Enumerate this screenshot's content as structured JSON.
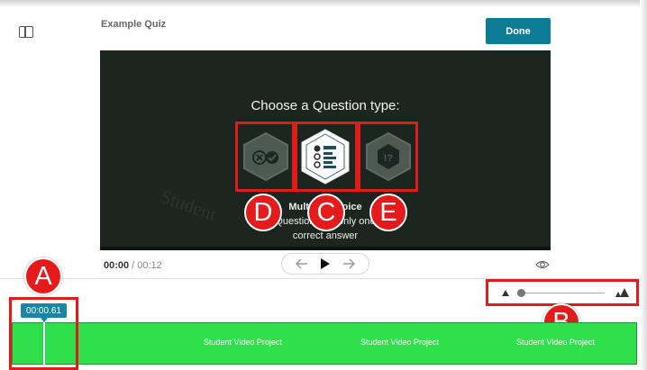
{
  "header": {
    "quiz_title": "Example Quiz",
    "done_label": "Done"
  },
  "video": {
    "watermark": "Student",
    "prompt": "Choose a Question type:",
    "question_types": [
      {
        "letter": "D",
        "icon": "true-false-icon"
      },
      {
        "letter": "C",
        "icon": "multiple-choice-icon"
      },
      {
        "letter": "E",
        "icon": "reveal-question-icon"
      }
    ],
    "description": {
      "line1": "Multiple Choice",
      "line2": "Question with only one",
      "line3": "correct answer"
    }
  },
  "annotations": {
    "a": "A",
    "b": "B",
    "c": "C",
    "d": "D",
    "e": "E"
  },
  "player": {
    "current_time": "00:00",
    "separator": "/",
    "total_time": "00:12",
    "zoom_level": 0.02
  },
  "timeline": {
    "playhead_time": "00:00.61",
    "track_labels": [
      "Student Video Project",
      "Student Video Project",
      "Student Video Project"
    ],
    "track_color": "#2fe04d"
  },
  "colors": {
    "accent": "#0d7d95",
    "highlight": "#e01b1b",
    "video_bg": "#1c2520"
  }
}
